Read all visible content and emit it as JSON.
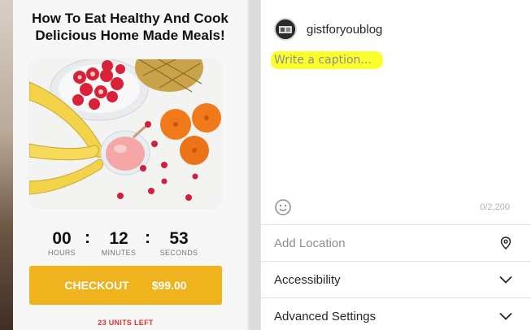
{
  "post": {
    "headline": "How To Eat Healthy And Cook Delicious Home Made Meals!",
    "timer": {
      "hours": "00",
      "minutes": "12",
      "seconds": "53",
      "separator": ":",
      "hours_label": "HOURS",
      "minutes_label": "MINUTES",
      "seconds_label": "SECONDS"
    },
    "checkout": {
      "label": "CHECKOUT",
      "price": "$99.00"
    },
    "units_left": "23 UNITS LEFT"
  },
  "account": {
    "username": "gistforyoublog"
  },
  "caption": {
    "placeholder": "Write a caption...",
    "value": "",
    "counter": "0/2,200",
    "highlight_color": "#fbff2c"
  },
  "settings": {
    "location": {
      "label": "Add Location",
      "icon": "location-pin-icon"
    },
    "accessibility": {
      "label": "Accessibility",
      "icon": "chevron-down-icon"
    },
    "advanced": {
      "label": "Advanced Settings",
      "icon": "chevron-down-icon"
    }
  },
  "colors": {
    "checkout_bg": "#eeb31d",
    "units_left": "#d9372d"
  }
}
